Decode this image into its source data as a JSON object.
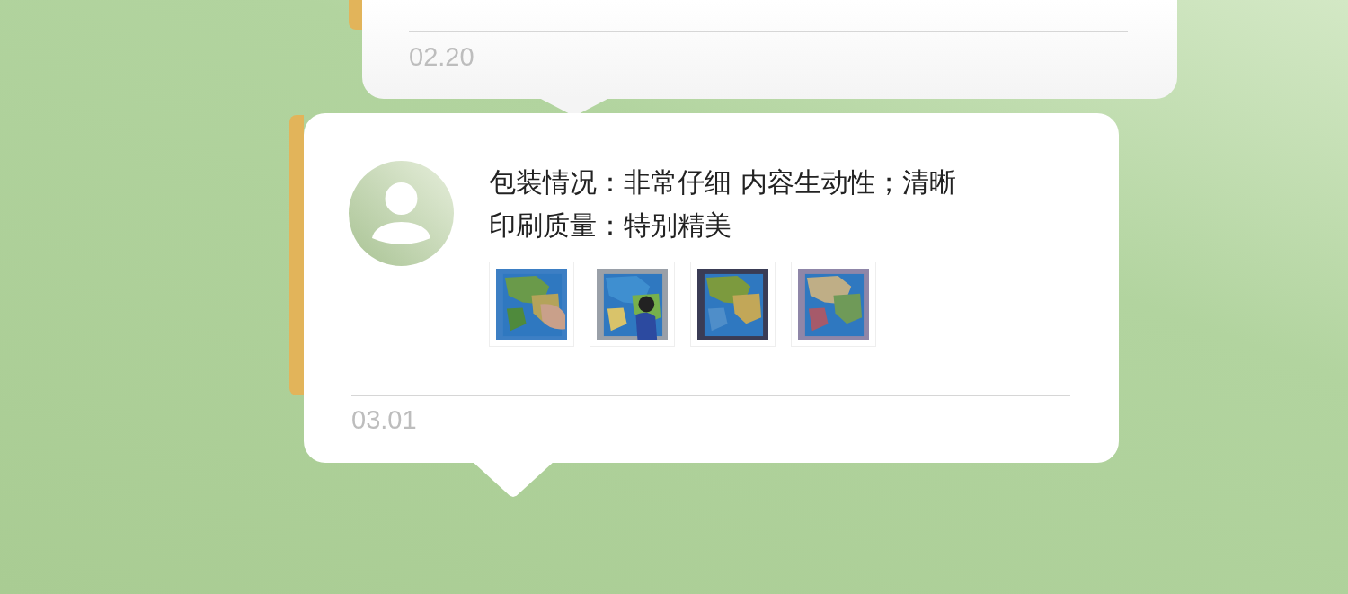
{
  "comments": [
    {
      "date": "02.20"
    },
    {
      "lines": [
        "包装情况：非常仔细 内容生动性；清晰",
        "印刷质量：特别精美"
      ],
      "date": "03.01"
    }
  ]
}
